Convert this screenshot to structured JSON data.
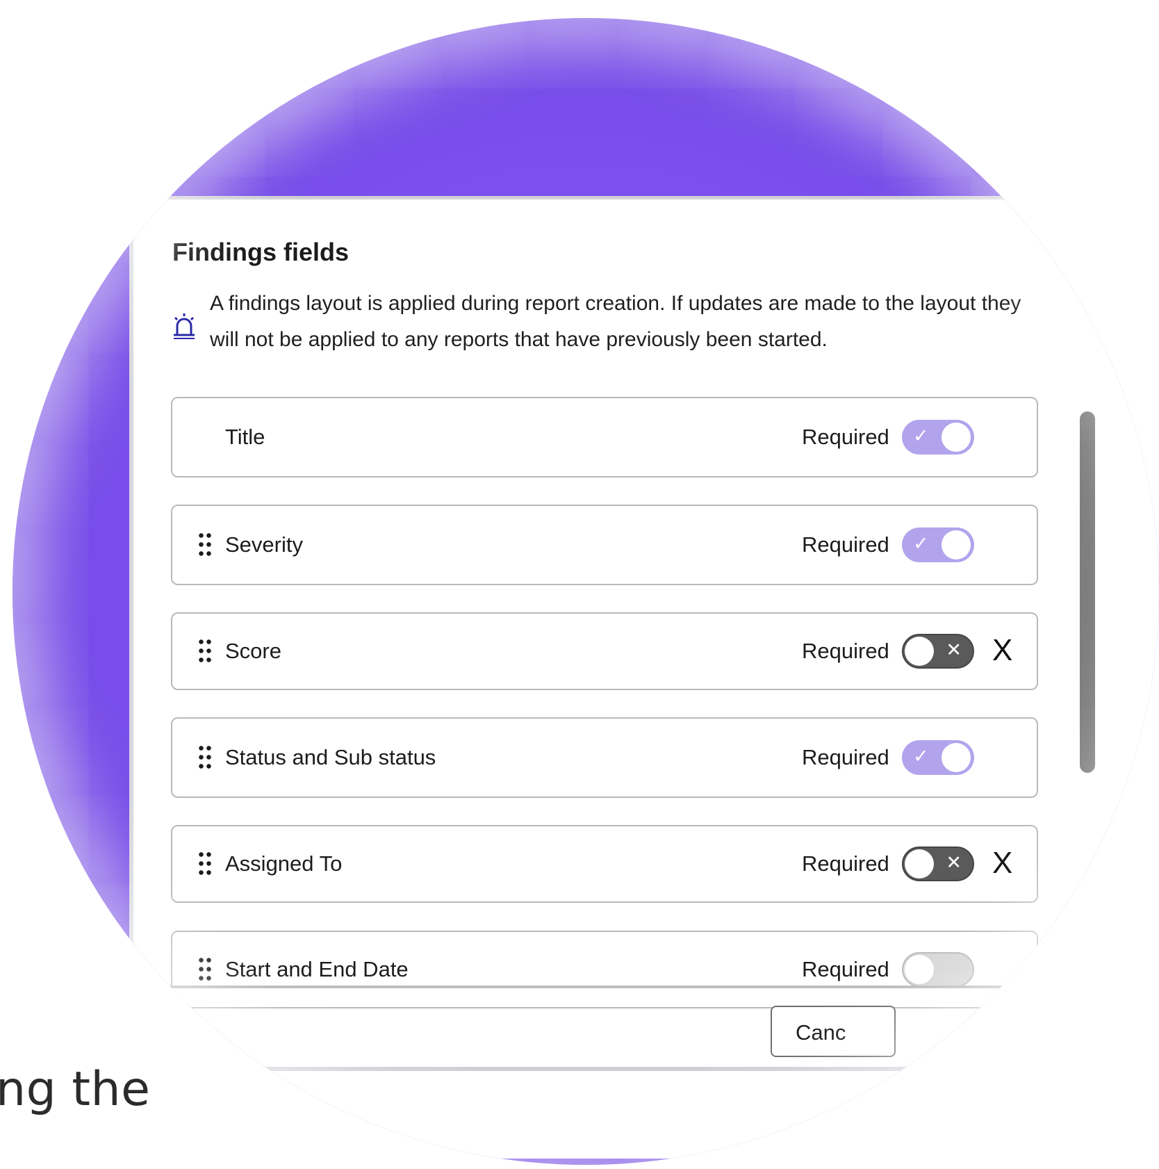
{
  "background": {
    "partial_text": "ng the"
  },
  "panel": {
    "title": "Findings fields",
    "info_icon": "alarm-light-icon",
    "info_text": "A findings layout is applied during report creation. If updates are made to the layout they will not be applied to any reports that have previously been started."
  },
  "fields": [
    {
      "label": "Title",
      "required_label": "Required",
      "required": true,
      "draggable": false,
      "removable": false
    },
    {
      "label": "Severity",
      "required_label": "Required",
      "required": true,
      "draggable": true,
      "removable": false
    },
    {
      "label": "Score",
      "required_label": "Required",
      "required": false,
      "draggable": true,
      "removable": true
    },
    {
      "label": "Status and Sub status",
      "required_label": "Required",
      "required": true,
      "draggable": true,
      "removable": false
    },
    {
      "label": "Assigned To",
      "required_label": "Required",
      "required": false,
      "draggable": true,
      "removable": true
    },
    {
      "label": "Start and End Date",
      "required_label": "Required",
      "required": false,
      "draggable": true,
      "removable": false
    }
  ],
  "toggle_glyphs": {
    "on": "✓",
    "off": "✕"
  },
  "remove_glyph": "X",
  "footer": {
    "cancel_label": "Canc"
  },
  "colors": {
    "accent_purple": "#7b4fee",
    "toggle_on": "#b2a4ec",
    "toggle_off": "#5a5a5a"
  }
}
